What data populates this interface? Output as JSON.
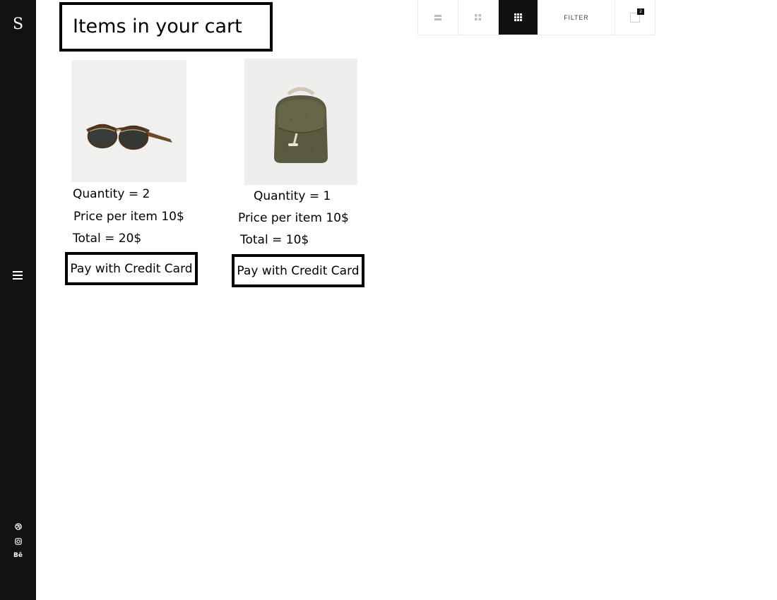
{
  "sidebar": {
    "logo_text": "S",
    "menu_icon": "hamburger-icon",
    "social": [
      "dribbble-icon",
      "instagram-icon",
      "behance-icon"
    ],
    "behance_text": "Bē"
  },
  "header": {
    "title": "Items in your cart"
  },
  "toolbar": {
    "views": [
      "list-view-icon",
      "grid-2-view-icon",
      "grid-3-view-icon"
    ],
    "active_view": "grid-3-view-icon",
    "filter_label": "FILTER",
    "cart_count": "2"
  },
  "cart": {
    "items": [
      {
        "image": "sunglasses",
        "quantity_text": "Quantity =  2",
        "price_text": "Price per item 10$",
        "total_text": "Total = 20$",
        "pay_label": "Pay with Credit Card"
      },
      {
        "image": "backpack",
        "quantity_text": "Quantity = 1",
        "price_text": "Price per item 10$",
        "total_text": "Total = 10$",
        "pay_label": "Pay with Credit Card"
      }
    ]
  },
  "colors": {
    "sidebar_bg": "#121212",
    "active_toolbar_bg": "#111111",
    "page_bg": "#ffffff"
  }
}
